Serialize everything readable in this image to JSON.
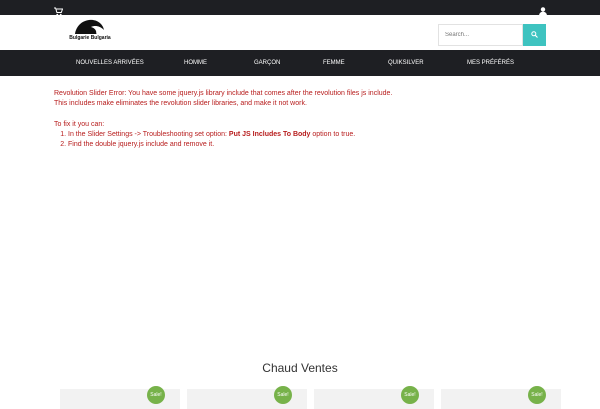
{
  "topbar": {
    "cart_icon": "cart-icon",
    "user_icon": "user-icon"
  },
  "logo": {
    "text": "Bulgarie Bulgaria"
  },
  "search": {
    "placeholder": "Search...",
    "button_icon": "search-icon"
  },
  "nav": {
    "items": [
      {
        "label": "NOUVELLES ARRIVÉES"
      },
      {
        "label": "HOMME"
      },
      {
        "label": "GARÇON"
      },
      {
        "label": "FEMME"
      },
      {
        "label": "QUIKSILVER"
      },
      {
        "label": "MES PRÉFÉRÉS"
      }
    ]
  },
  "error": {
    "line1": "Revolution Slider Error: You have some jquery.js library include that comes after the revolution files js include.",
    "line2": "This includes make eliminates the revolution slider libraries, and make it not work.",
    "fix_intro": "To fix it you can:",
    "step1_before": "In the Slider Settings -> Troubleshooting set option: ",
    "step1_bold": "Put JS Includes To Body",
    "step1_after": " option to true.",
    "step2": "Find the double jquery.js include and remove it."
  },
  "hot_sales": {
    "title": "Chaud Ventes",
    "badges": [
      "Sale!",
      "Sale!",
      "Sale!",
      "Sale!"
    ]
  },
  "colors": {
    "dark": "#1e1f23",
    "accent": "#3ec3c0",
    "error": "#b71c1c",
    "badge": "#77b24a"
  }
}
